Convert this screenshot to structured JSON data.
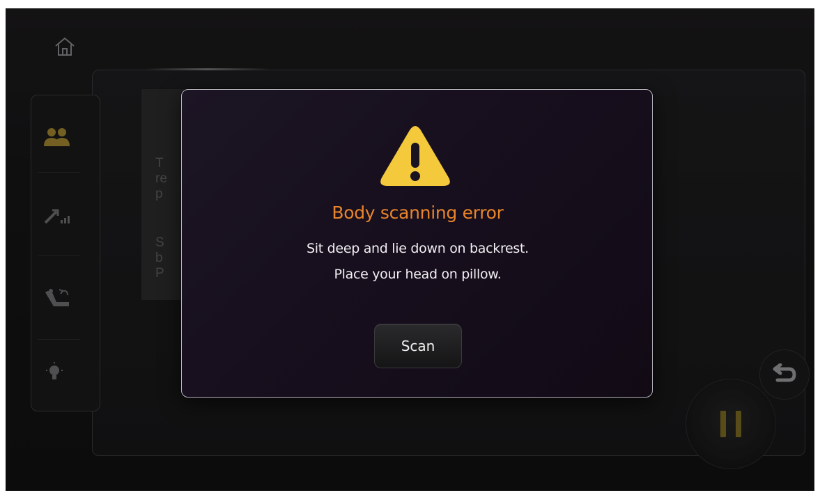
{
  "dialog": {
    "title": "Body scanning error",
    "message_line1": "Sit deep and lie down on backrest.",
    "message_line2": "Place your head on pillow.",
    "scan_label": "Scan"
  },
  "background_tips": {
    "line1": "T",
    "line2": "re",
    "line3": "p",
    "line4": "S",
    "line5": "b",
    "line6": "P"
  },
  "sidebar": {
    "items": [
      {
        "icon": "users-icon"
      },
      {
        "icon": "intensity-icon"
      },
      {
        "icon": "recline-chair-icon"
      },
      {
        "icon": "light-bulb-icon"
      }
    ]
  },
  "colors": {
    "accent_orange": "#e8842b",
    "warning_yellow": "#f5c93c",
    "gold": "#a08530"
  }
}
